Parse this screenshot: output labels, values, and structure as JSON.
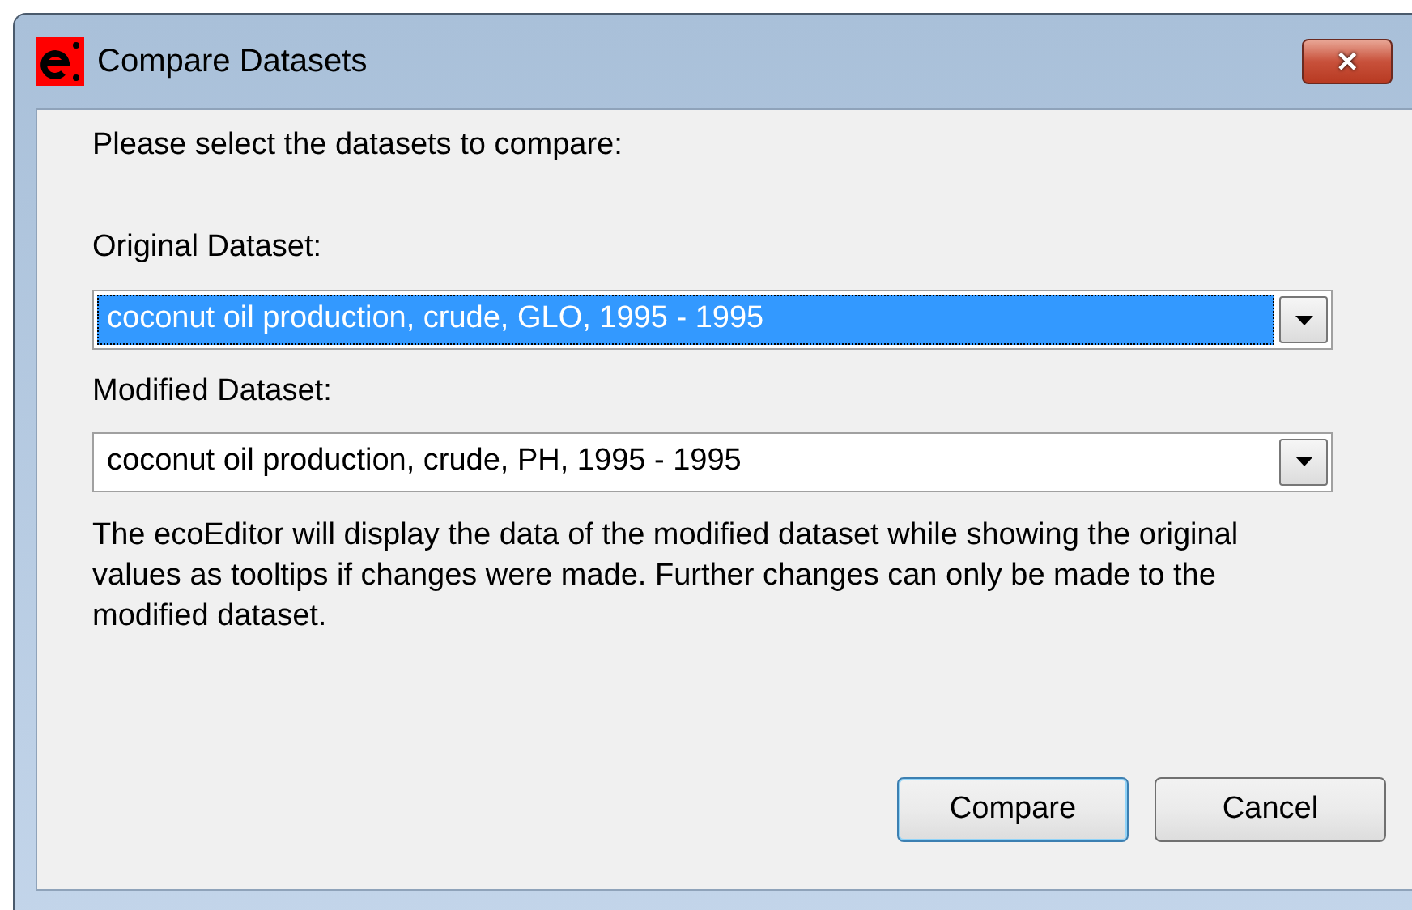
{
  "window": {
    "title": "Compare Datasets",
    "close": "✕"
  },
  "prompt": "Please select the datasets to compare:",
  "fields": [
    {
      "label": "Original Dataset:",
      "value": "coconut oil production, crude, GLO, 1995 - 1995",
      "selected": true
    },
    {
      "label": "Modified Dataset:",
      "value": "coconut oil production, crude, PH, 1995 - 1995",
      "selected": false
    }
  ],
  "note": "The ecoEditor will display the data of the modified dataset while showing the original values as tooltips if changes were made. Further changes can only be made to the modified dataset.",
  "buttons": [
    {
      "label": "Compare",
      "default": true
    },
    {
      "label": "Cancel",
      "default": false
    }
  ]
}
